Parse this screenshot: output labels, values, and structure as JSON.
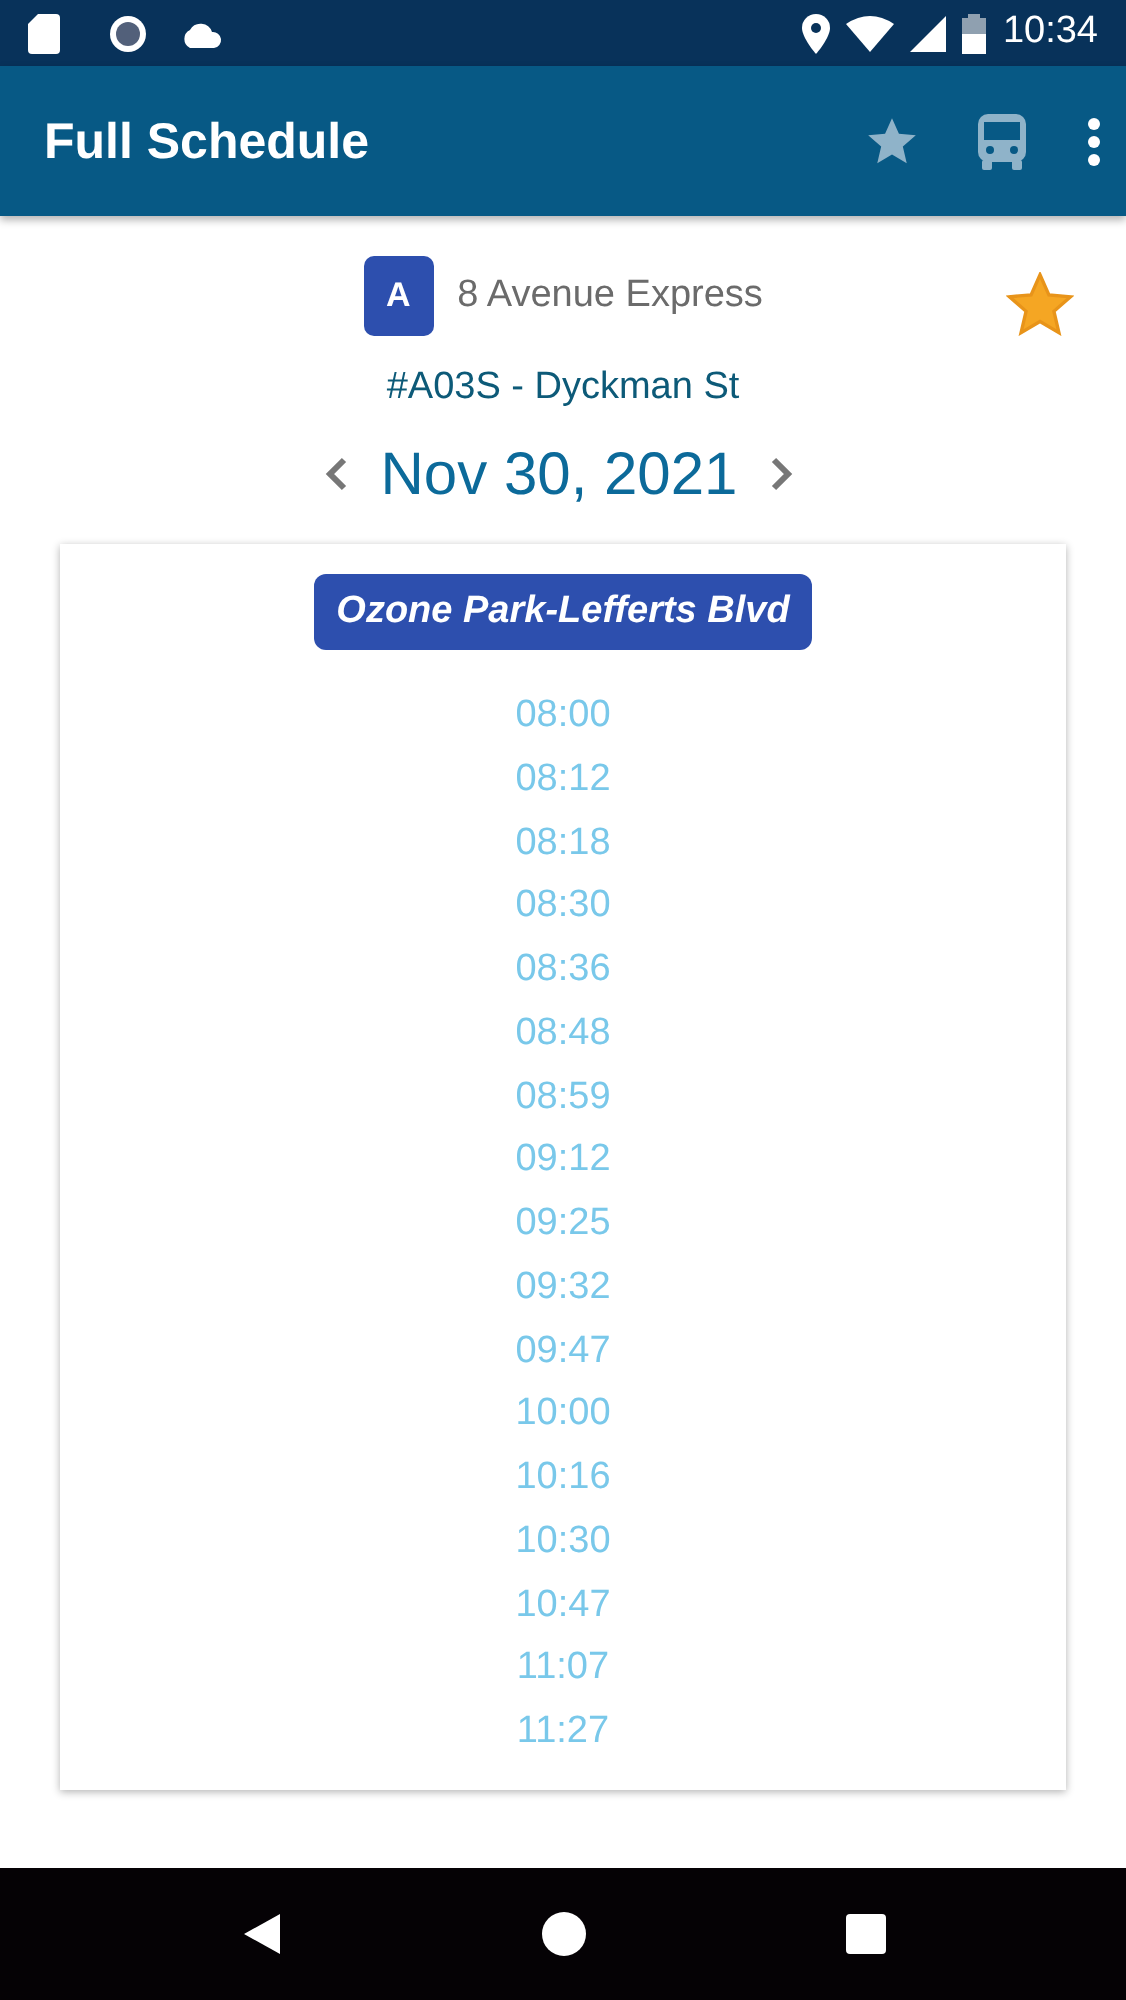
{
  "status_bar": {
    "time": "10:34"
  },
  "app_bar": {
    "title": "Full Schedule"
  },
  "route": {
    "letter": "A",
    "name": "8 Avenue Express",
    "favorite": true
  },
  "stop": "#A03S - Dyckman St",
  "date": "Nov 30, 2021",
  "direction": "Ozone Park-Lefferts Blvd",
  "times": [
    "08:00",
    "08:12",
    "08:18",
    "08:30",
    "08:36",
    "08:48",
    "08:59",
    "09:12",
    "09:25",
    "09:32",
    "09:47",
    "10:00",
    "10:16",
    "10:30",
    "10:47",
    "11:07",
    "11:27"
  ]
}
